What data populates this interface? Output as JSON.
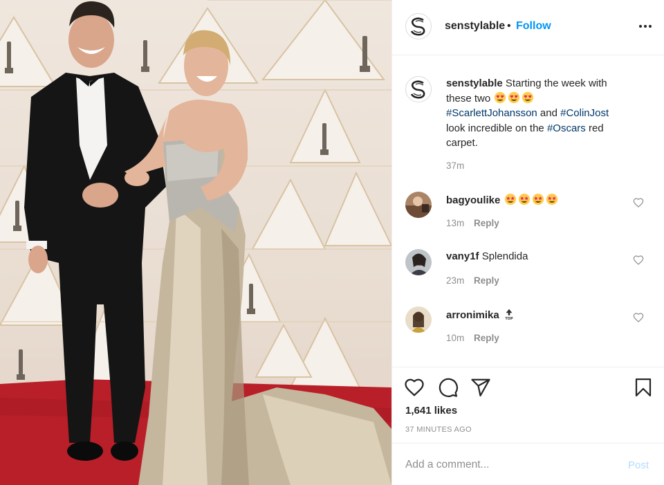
{
  "post": {
    "username": "senstylable",
    "dot": "•",
    "follow_label": "Follow",
    "more_icon": "more-horizontal-icon",
    "brand_color": "#0095f6",
    "hashtag_color": "#00376b",
    "caption": {
      "username": "senstylable",
      "line1": "Starting the week with",
      "line2_text": "these two",
      "emoji_icon": "heart-eyes-emoji",
      "tag1": "#ScarlettJohansson",
      "and_word": "and",
      "tag2": "#ColinJost",
      "line4": "look incredible on the",
      "tag3": "#Oscars",
      "red_word": "red",
      "line5": "carpet.",
      "time": "37m"
    },
    "comments": [
      {
        "username": "bagyoulike",
        "text": "",
        "emoji": "star-struck-emoji x4",
        "time": "13m",
        "reply_label": "Reply"
      },
      {
        "username": "vany1f",
        "text": "Splendida",
        "time": "23m",
        "reply_label": "Reply"
      },
      {
        "username": "arronimika",
        "text": "",
        "emoji": "top-arrow-emoji",
        "time": "10m",
        "reply_label": "Reply"
      }
    ],
    "likes": "1,641 likes",
    "posted_ago": "37 MINUTES AGO",
    "comment_placeholder": "Add a comment...",
    "post_label": "Post",
    "post_color_disabled": "#b3dbff"
  }
}
